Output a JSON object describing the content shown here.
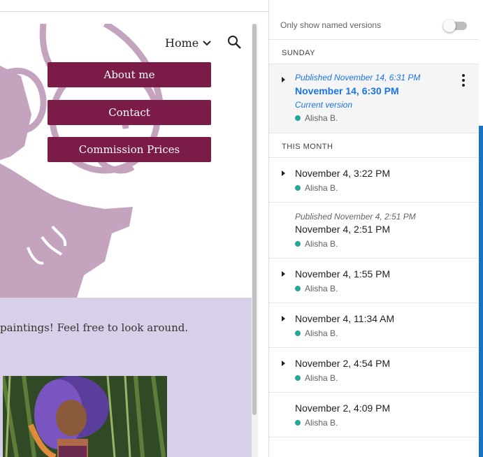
{
  "site": {
    "nav_home": "Home",
    "menu": [
      "About me",
      "Contact",
      "Commission Prices"
    ],
    "intro_text": "paintings! Feel free to look around."
  },
  "history": {
    "toggle_label": "Only show named versions",
    "toggle_on": false,
    "sections": [
      {
        "label": "SUNDAY",
        "versions": [
          {
            "published": "Published November 14, 6:31 PM",
            "date": "November 14, 6:30 PM",
            "current_label": "Current version",
            "author": "Alisha B.",
            "expandable": true,
            "current": true
          }
        ]
      },
      {
        "label": "THIS MONTH",
        "versions": [
          {
            "published": "",
            "date": "November 4, 3:22 PM",
            "author": "Alisha B.",
            "expandable": true
          },
          {
            "published": "Published November 4, 2:51 PM",
            "date": "November 4, 2:51 PM",
            "author": "Alisha B.",
            "expandable": false
          },
          {
            "published": "",
            "date": "November 4, 1:55 PM",
            "author": "Alisha B.",
            "expandable": true
          },
          {
            "published": "",
            "date": "November 4, 11:34 AM",
            "author": "Alisha B.",
            "expandable": true
          },
          {
            "published": "",
            "date": "November 2, 4:54 PM",
            "author": "Alisha B.",
            "expandable": true
          },
          {
            "published": "",
            "date": "November 2, 4:09 PM",
            "author": "Alisha B.",
            "expandable": false
          }
        ]
      }
    ]
  },
  "icons": {
    "search": "search-icon",
    "chevron": "chevron-down-icon",
    "more": "more-vert-icon",
    "expand": "triangle-right-icon"
  },
  "colors": {
    "menu_button": "#7a1b48",
    "hero_art": "#c4a3bf",
    "lavender_band": "#d8d0e8",
    "accent_blue": "#1a73e8",
    "author_dot": "#26a69a"
  }
}
